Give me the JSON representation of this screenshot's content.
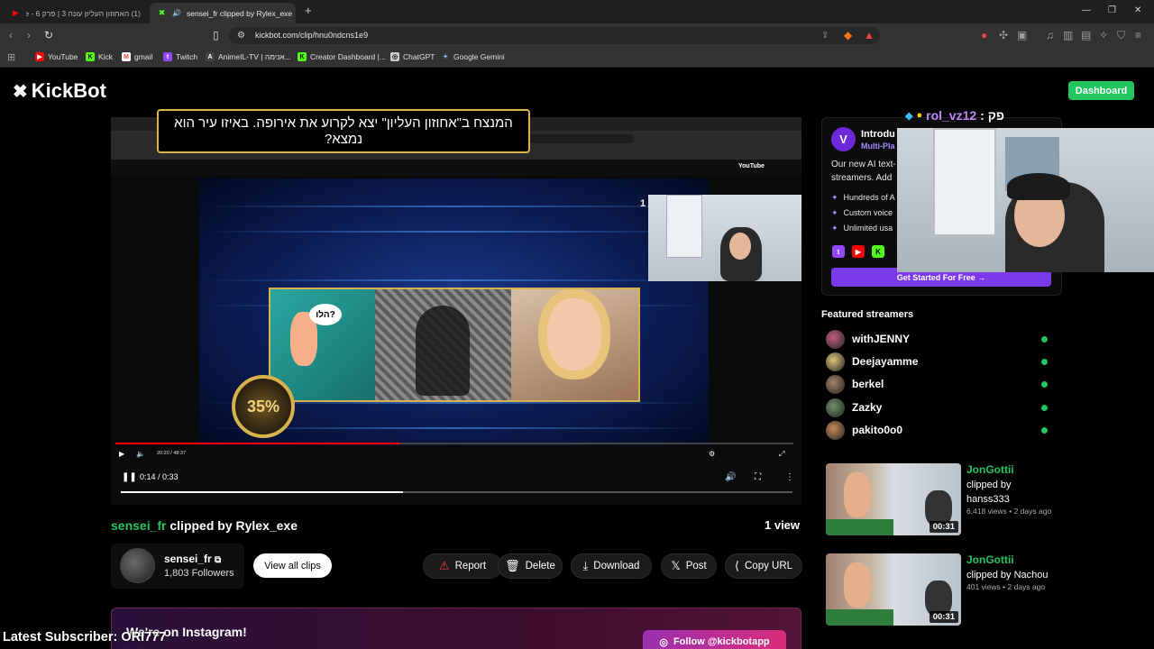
{
  "browser": {
    "tabs": [
      {
        "label": "(1) האחוזון העליון עונה 3 | פרק 6 - be",
        "active": false
      },
      {
        "label": "sensei_fr clipped by Rylex_exe",
        "active": true
      }
    ],
    "url": "kickbot.com/clip/hnu0ndcns1e9",
    "bookmarks": [
      "YouTube",
      "Kick",
      "gmail",
      "Twitch",
      "AnimeIL-TV | אנימה...",
      "Creator Dashboard |...",
      "ChatGPT",
      "Google Gemini"
    ]
  },
  "site": {
    "logo": "KickBot",
    "dashboard_label": "Dashboard"
  },
  "video": {
    "question": "המנצח ב\"אחוזון העליון\" יצא לקרוע את אירופה. באיזו עיר הוא נמצא?",
    "bubble_text": "הלו?",
    "lifeline": "35%",
    "inner_time": "20:20 / 48:37",
    "inner_progress": 0.42,
    "player_time": "0:14 / 0:33",
    "player_progress": 0.42,
    "yt_logo": "YouTube"
  },
  "clip": {
    "streamer": "sensei_fr",
    "title_rest": "clipped by Rylex_exe",
    "views": "1 view",
    "channel_name": "sensei_fr",
    "followers": "1,803 Followers",
    "view_all": "View all clips",
    "actions": {
      "report": "Report",
      "delete": "Delete",
      "download": "Download",
      "post": "Post",
      "copy": "Copy URL"
    }
  },
  "instagram": {
    "text": "We're on Instagram!",
    "button": "Follow @kickbotapp"
  },
  "overlay": {
    "subscriber": "Latest Subscriber: ORI777",
    "chat_name": "rol_vz12",
    "chat_suffix": ": פק"
  },
  "ad": {
    "title": "Introdu",
    "subtitle": "Multi-Pla",
    "line1": "Our new AI text-",
    "line2": "streamers. Add",
    "bullets": [
      "Hundreds of A",
      "Custom voice",
      "Unlimited usa"
    ],
    "cta": "Get Started For Free →"
  },
  "featured": {
    "heading": "Featured streamers",
    "streamers": [
      {
        "name": "withJENNY",
        "color": "#c0607a"
      },
      {
        "name": "Deejayamme",
        "color": "#d9c27a"
      },
      {
        "name": "berkel",
        "color": "#a08466"
      },
      {
        "name": "Zazky",
        "color": "#6e8f6a"
      },
      {
        "name": "pakito0o0",
        "color": "#c48a5a"
      }
    ]
  },
  "related": [
    {
      "streamer": "JonGottii",
      "by": "clipped by hanss333",
      "meta": "6,418 views • 2 days ago",
      "duration": "00:31"
    },
    {
      "streamer": "JonGottii",
      "by": "clipped by Nachou",
      "meta": "401 views • 2 days ago",
      "duration": "00:31"
    }
  ],
  "colors": {
    "accent": "#22c55e",
    "purple": "#7c3aed",
    "background": "#000000"
  }
}
